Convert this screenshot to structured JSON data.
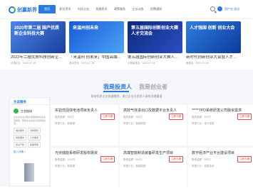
{
  "header": {
    "logo": "创赢新界",
    "nav": [
      "首页",
      "职位资讯",
      "科技企业",
      "投融资讯",
      "政策服务",
      "企业动态",
      "招聘通知"
    ],
    "user": "用户名 退出"
  },
  "cards": [
    {
      "banner": "2020年第二届 国产优质新企业科技大赛",
      "title": "2022年二届优质科技创新企业赛开幕仪式",
      "meta": "中国企业 · 2022-07-15"
    },
    {
      "banner": "来温州创未来",
      "title": "「来温州 创未来」中国高端人才交流会",
      "meta": "温州发布 · 2022-07-15"
    },
    {
      "banner": "第五届国际创新创业大赛 人才交流会",
      "title": "第五届国际创新创业大赛人才交流会开幕",
      "meta": "大赛组委会 · 2022-07-15"
    },
    {
      "banner": "人才强国 创新 创业大会",
      "title": "新时代创新创业大会暨人才交流会",
      "meta": "组委会 · 2022-07-15"
    }
  ],
  "section": {
    "tab_active": "我是投资人",
    "tab_other": "我是创业者",
    "subtitle": "帮助优质企业快速融资，建立企业与投资人高效沟通渠道"
  },
  "sidebar": {
    "head": "生态服务",
    "item": "生态链接",
    "desc": "企业在创业过程中需要各种生态资源服务，帮助企业快速对接所需资源。",
    "pills": [
      "融资服务",
      "法律服务",
      "财税服务",
      "人才服务",
      "知识产权",
      "政策申报"
    ],
    "link": "进入详情 >"
  },
  "jobs": [
    {
      "title": "实验性固体电池项目负责人",
      "l1": "融资金额：500万",
      "l2": "所属行业：新能源",
      "btn": "立即沟通"
    },
    {
      "title": "高效气体进出口及数据平台负责人",
      "l1": "融资金额：300万",
      "l2": "所属行业：智能制造",
      "btn": "立即沟通"
    },
    {
      "title": "*****TPO系统研发公司融资需求",
      "l1": "融资金额：200万",
      "l2": "所属行业：电子信息",
      "btn": "立即沟通"
    },
    {
      "title": "光伏储能系统研发股权融资",
      "l1": "融资金额：1000万",
      "l2": "所属行业：新能源",
      "btn": "立即沟通"
    },
    {
      "title": "高端智能制造装备研发生产项目",
      "l1": "融资金额：800万",
      "l2": "所属行业：智能制造",
      "btn": "立即沟通"
    },
    {
      "title": "数字经济产业平台建设项目",
      "l1": "融资金额：500万",
      "l2": "所属行业：信息技术",
      "btn": "立即沟通"
    }
  ]
}
